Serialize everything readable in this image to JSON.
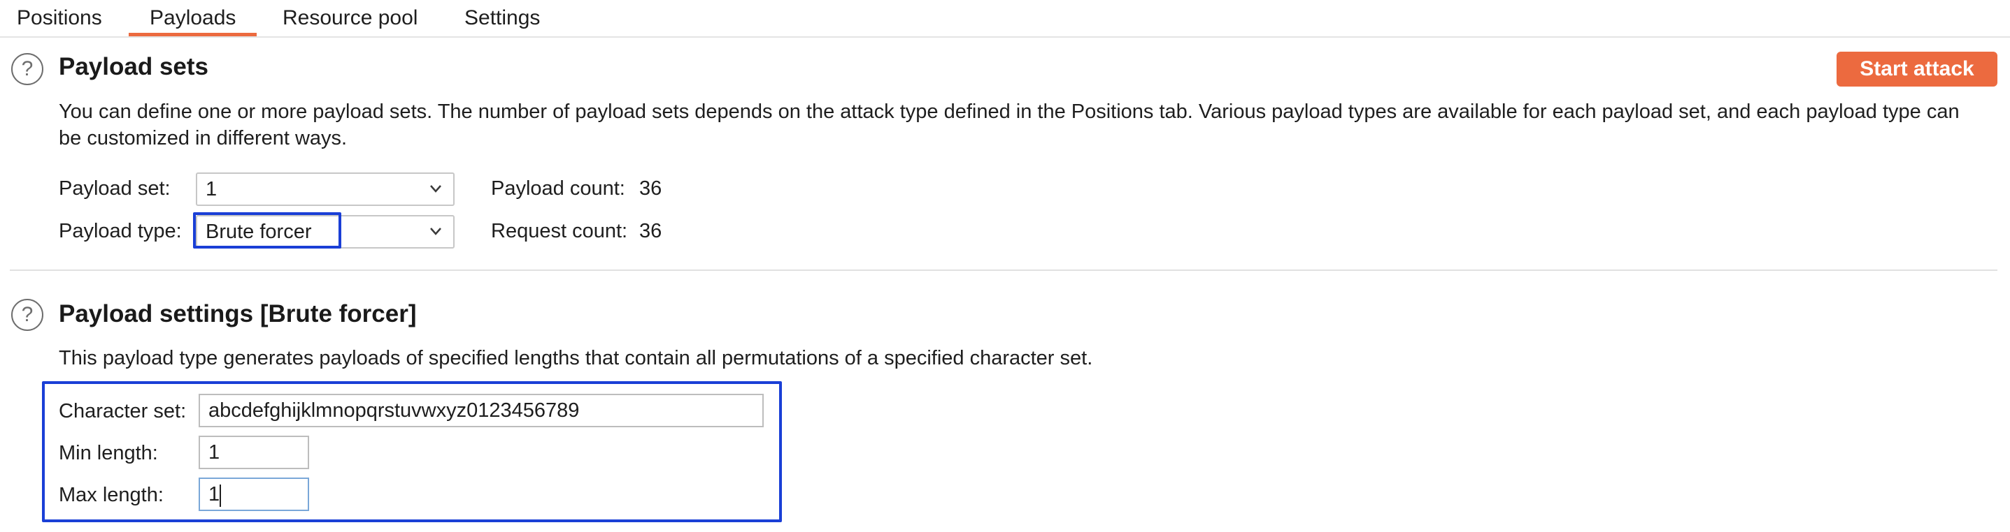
{
  "tabs": [
    {
      "label": "Positions",
      "active": false
    },
    {
      "label": "Payloads",
      "active": true
    },
    {
      "label": "Resource pool",
      "active": false
    },
    {
      "label": "Settings",
      "active": false
    }
  ],
  "payload_sets": {
    "title": "Payload sets",
    "start_attack_label": "Start attack",
    "description": "You can define one or more payload sets. The number of payload sets depends on the attack type defined in the Positions tab. Various payload types are available for each payload set, and each payload type can be customized in different ways.",
    "payload_set_label": "Payload set:",
    "payload_set_value": "1",
    "payload_type_label": "Payload type:",
    "payload_type_value": "Brute forcer",
    "payload_count_label": "Payload count:",
    "payload_count_value": "36",
    "request_count_label": "Request count:",
    "request_count_value": "36"
  },
  "payload_settings": {
    "title": "Payload settings [Brute forcer]",
    "description": "This payload type generates payloads of specified lengths that contain all permutations of a specified character set.",
    "character_set_label": "Character set:",
    "character_set_value": "abcdefghijklmnopqrstuvwxyz0123456789",
    "min_length_label": "Min length:",
    "min_length_value": "1",
    "max_length_label": "Max length:",
    "max_length_value": "1"
  },
  "icons": {
    "help": "?",
    "chevron": "chevron-down-icon"
  },
  "colors": {
    "accent": "#ec6a3f",
    "focus_outline": "#1a3fd6",
    "active_field_border": "#7aa7d8"
  }
}
